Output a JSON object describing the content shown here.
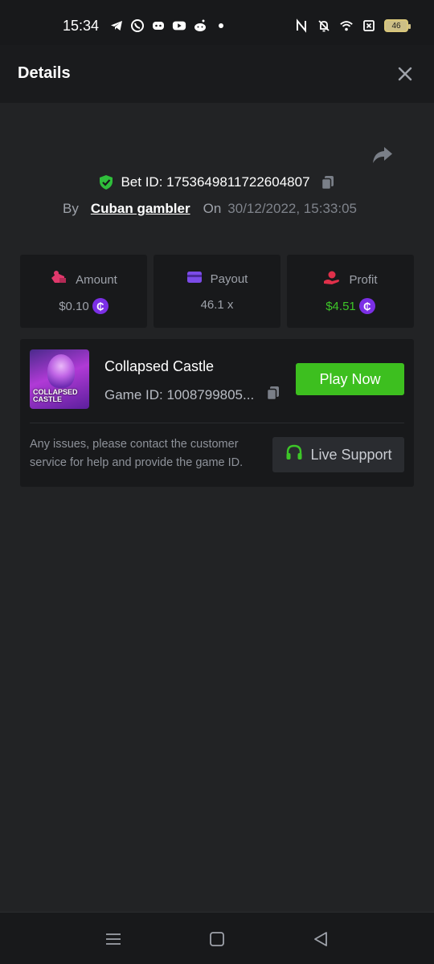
{
  "status_bar": {
    "time": "15:34",
    "battery": "46",
    "left_icons": [
      "telegram-icon",
      "whatsapp-icon",
      "discord-icon",
      "youtube-icon",
      "reddit-icon",
      "dot-icon"
    ],
    "right_icons": [
      "nfc-icon",
      "bell-off-icon",
      "wifi-icon",
      "sim-icon",
      "battery-icon"
    ]
  },
  "header": {
    "title": "Details",
    "close_icon": "close-icon"
  },
  "bet": {
    "id_label": "Bet ID: 1753649811722604807",
    "by_label": "By",
    "user": "Cuban gambler",
    "on_label": "On",
    "datetime": "30/12/2022, 15:33:05"
  },
  "stats": {
    "amount": {
      "label": "Amount",
      "value": "$0.10"
    },
    "payout": {
      "label": "Payout",
      "value": "46.1 x"
    },
    "profit": {
      "label": "Profit",
      "value": "$4.51"
    },
    "coin_symbol": "₵"
  },
  "game": {
    "thumb_text_1": "COLLAPSED",
    "thumb_text_2": "CASTLE",
    "name": "Collapsed Castle",
    "id_label": "Game ID: 1008799805...",
    "play_label": "Play Now",
    "help_text": "Any issues, please contact the customer service for help and provide the game ID.",
    "support_label": "Live Support"
  },
  "colors": {
    "accent_green": "#3dbf1f",
    "profit_green": "#3dc628",
    "coin_purple": "#7b2fe6",
    "background": "#222325"
  }
}
